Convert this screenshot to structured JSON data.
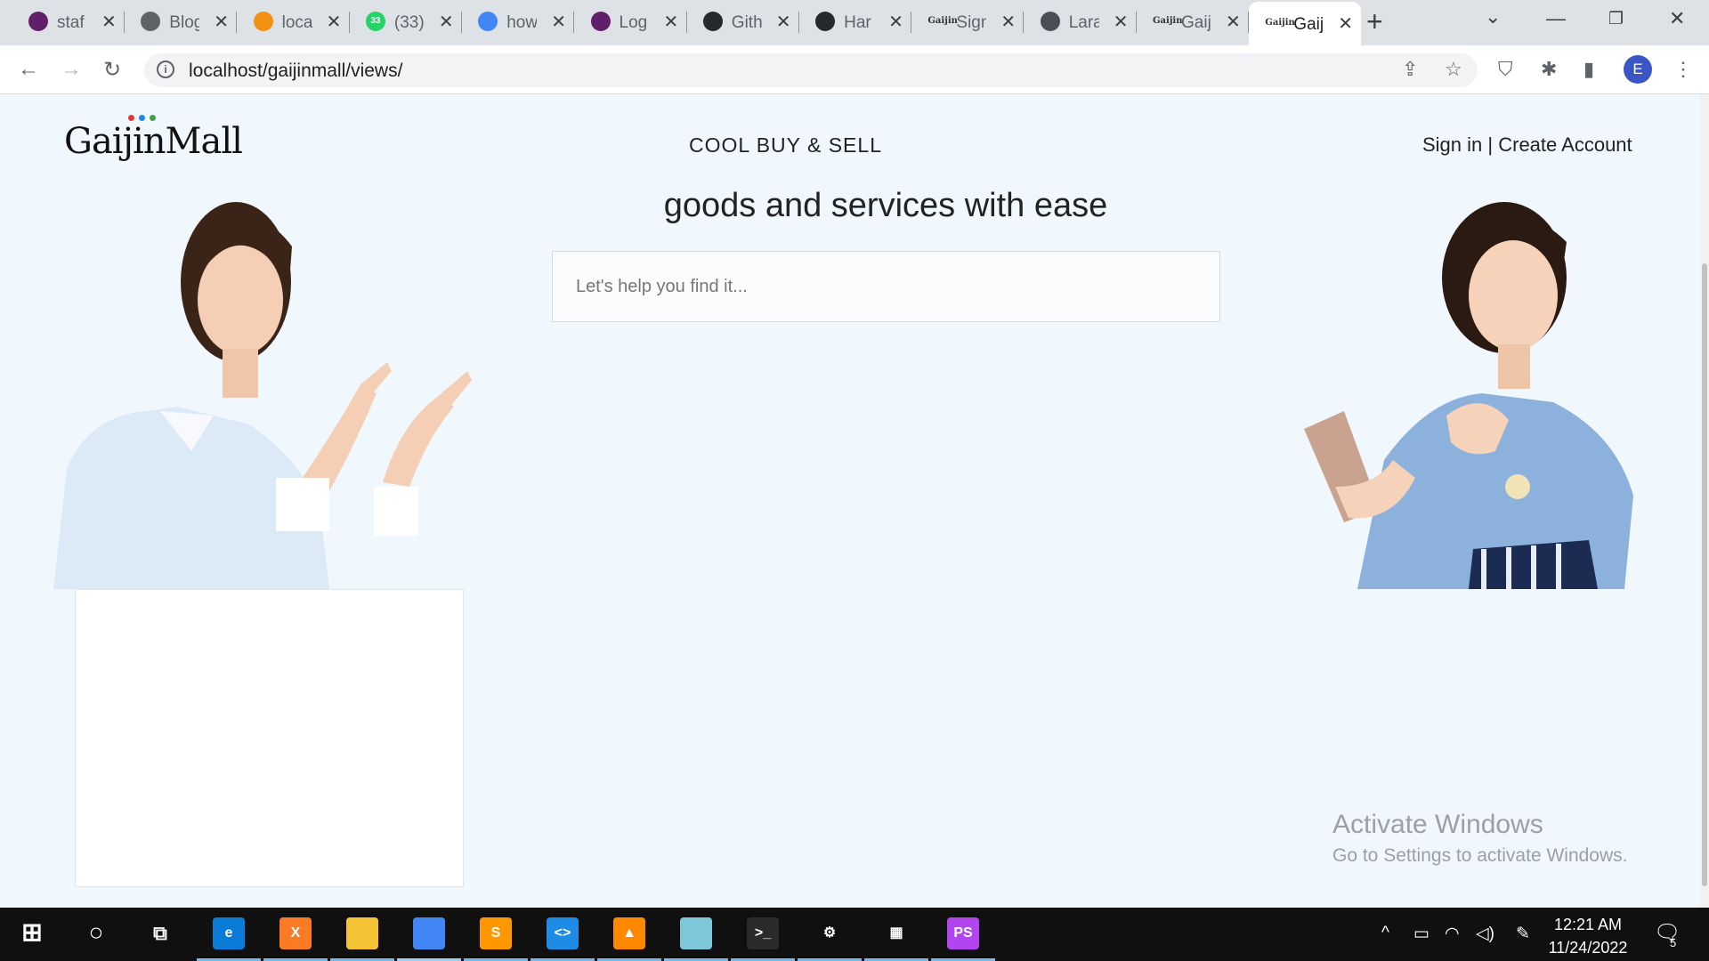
{
  "browser": {
    "tabs": [
      {
        "title": "staf",
        "icon": "slack-icon",
        "color": "#611f69"
      },
      {
        "title": "Blog",
        "icon": "globe-icon",
        "color": "#5f6368"
      },
      {
        "title": "loca",
        "icon": "phpmyadmin-icon",
        "color": "#f29111"
      },
      {
        "title": "(33)",
        "icon": "whatsapp-icon",
        "color": "#25d366",
        "badge": "33"
      },
      {
        "title": "how",
        "icon": "google-icon",
        "color": "#4285f4"
      },
      {
        "title": "Log",
        "icon": "slack-icon",
        "color": "#611f69"
      },
      {
        "title": "Gith",
        "icon": "github-icon",
        "color": "#24292e"
      },
      {
        "title": "Har",
        "icon": "github-icon",
        "color": "#24292e"
      },
      {
        "title": "Sign",
        "icon": "gaijin-icon",
        "color": "#333333",
        "fav_text": "Gaijin"
      },
      {
        "title": "Lara",
        "icon": "page-icon",
        "color": "#4a4f57"
      },
      {
        "title": "Gaij",
        "icon": "gaijin-icon",
        "color": "#333333",
        "fav_text": "Gaijin"
      },
      {
        "title": "Gaij",
        "icon": "gaijin-icon",
        "color": "#333333",
        "fav_text": "Gaijin",
        "active": true
      }
    ],
    "url": "localhost/gaijinmall/views/",
    "profile_initial": "E"
  },
  "site": {
    "logo": "GaijinMall",
    "logo_dot_colors": [
      "#e53935",
      "#1e88e5",
      "#43a047"
    ],
    "tagline": "COOL BUY & SELL",
    "sign_in": "Sign in",
    "divider": " | ",
    "create_account": "Create Account",
    "hero_text": "goods and services with ease",
    "search_placeholder": "Let's help you find it..."
  },
  "watermark": {
    "title": "Activate Windows",
    "subtitle": "Go to Settings to activate Windows."
  },
  "taskbar": {
    "apps": [
      {
        "name": "edge-icon",
        "color": "#0a7cd8",
        "glyph": "e"
      },
      {
        "name": "xampp-icon",
        "color": "#fb7a24",
        "glyph": "X"
      },
      {
        "name": "file-explorer-icon",
        "color": "#f3c335",
        "glyph": ""
      },
      {
        "name": "chrome-icon",
        "color": "#4285f4",
        "glyph": "",
        "active": true
      },
      {
        "name": "sublime-text-icon",
        "color": "#ff9800",
        "glyph": "S"
      },
      {
        "name": "vscode-icon",
        "color": "#1e8be6",
        "glyph": "<>"
      },
      {
        "name": "vlc-icon",
        "color": "#ff8800",
        "glyph": "▲"
      },
      {
        "name": "notepad-icon",
        "color": "#7ec6d9",
        "glyph": ""
      },
      {
        "name": "terminal-icon",
        "color": "#2b2b2b",
        "glyph": ">_"
      },
      {
        "name": "settings-icon",
        "color": "#101010",
        "glyph": "⚙"
      },
      {
        "name": "movies-icon",
        "color": "#101010",
        "glyph": "▦"
      },
      {
        "name": "phpstorm-icon",
        "color": "#b345f1",
        "glyph": "PS"
      }
    ],
    "time": "12:21 AM",
    "date": "11/24/2022",
    "notification_count": "5"
  }
}
